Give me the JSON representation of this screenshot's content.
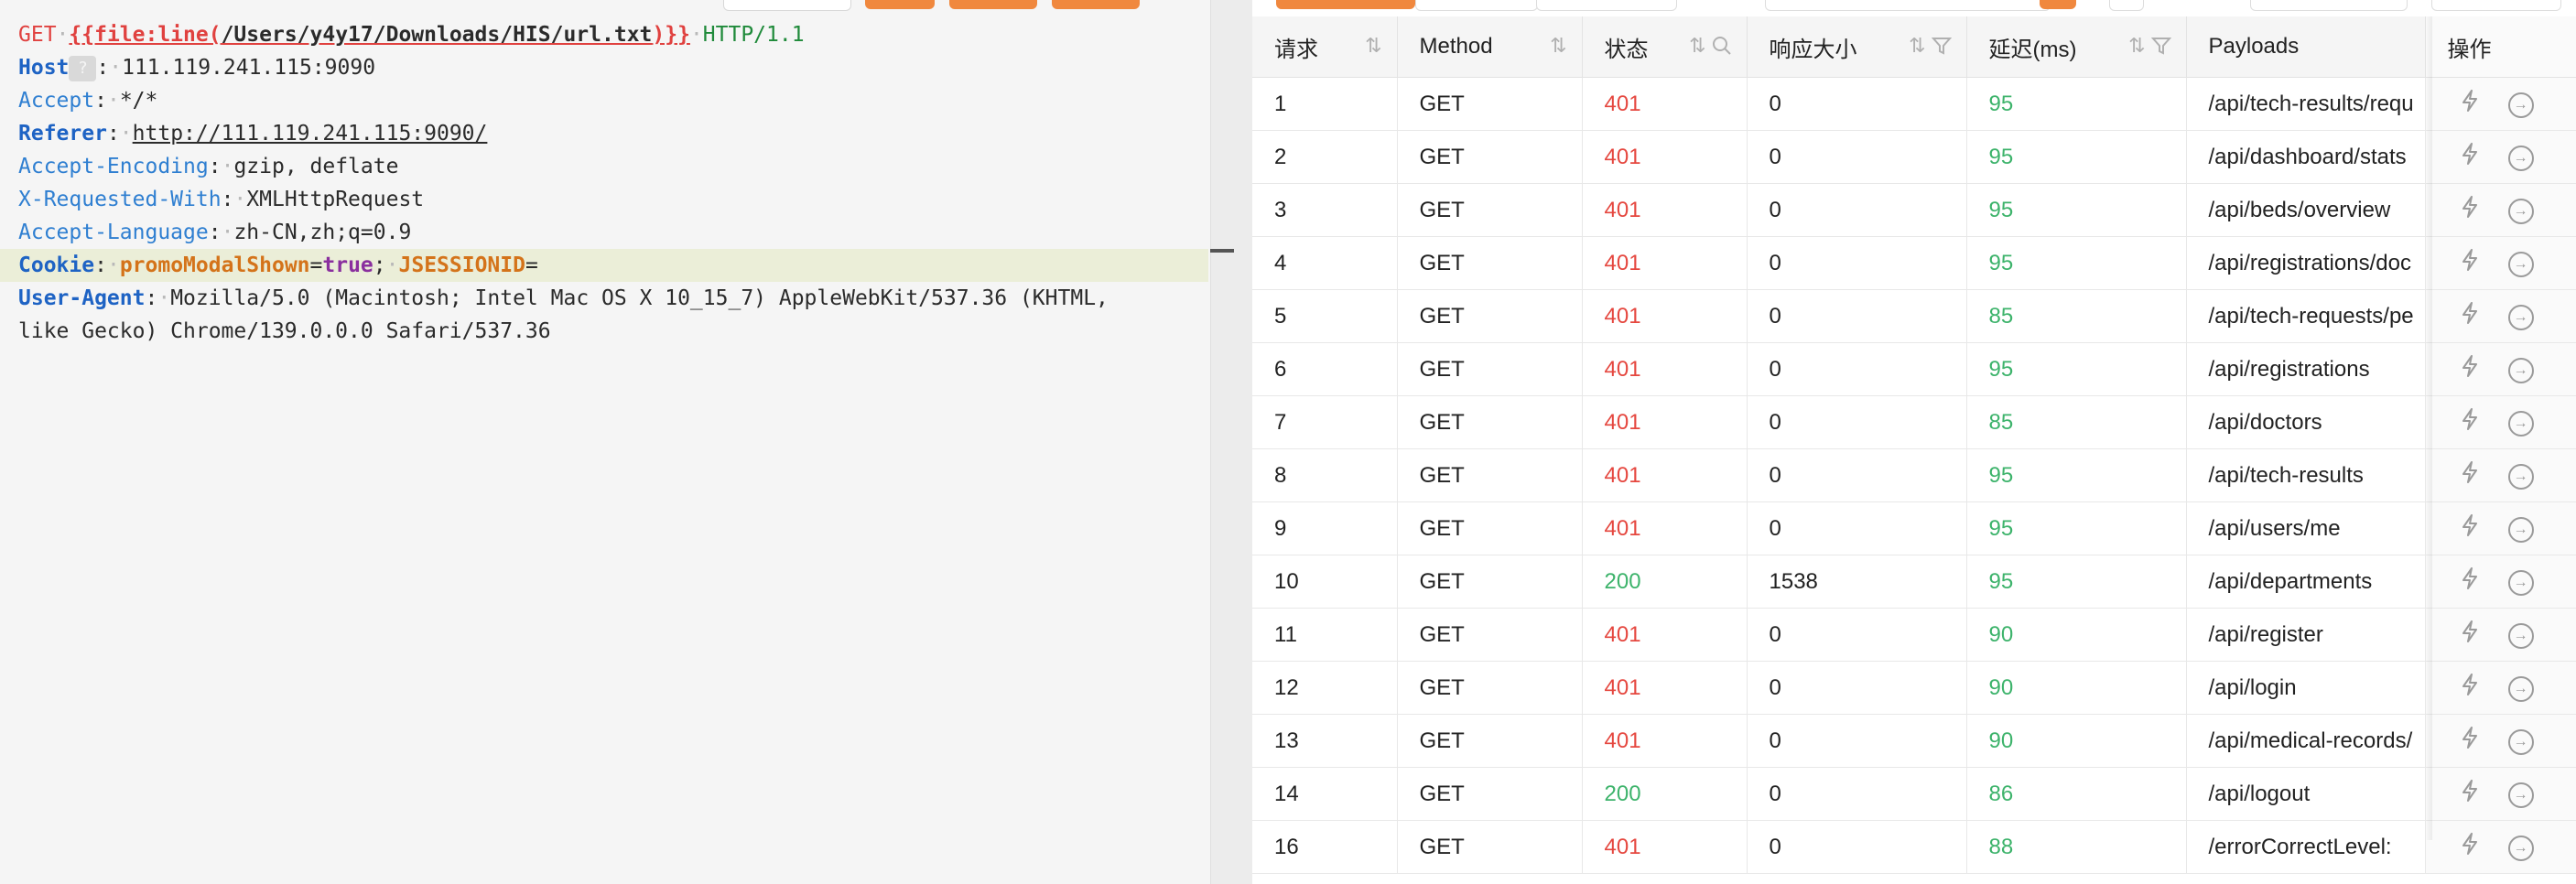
{
  "editor": {
    "request_line": {
      "method": "GET",
      "template_open": "{{file:line(",
      "template_path": "/Users/y4y17/Downloads/HIS/url.txt",
      "template_close": ")}}",
      "protocol": "HTTP/1.1"
    },
    "headers": [
      {
        "name": "Host",
        "value": "111.119.241.115:9090"
      },
      {
        "name": "Accept",
        "value": "*/*"
      },
      {
        "name": "Referer",
        "value": "http://111.119.241.115:9090/"
      },
      {
        "name": "Accept-Encoding",
        "value": "gzip, deflate"
      },
      {
        "name": "X-Requested-With",
        "value": "XMLHttpRequest"
      },
      {
        "name": "Accept-Language",
        "value": "zh-CN,zh;q=0.9"
      },
      {
        "name": "Cookie",
        "cookie1_name": "promoModalShown",
        "cookie1_value": "true",
        "cookie2_name": "JSESSIONID",
        "eq": "="
      },
      {
        "name": "User-Agent",
        "value_line1": "Mozilla/5.0 (Macintosh; Intel Mac OS X 10_15_7) AppleWebKit/537.36 (KHTML,",
        "value_line2": "like Gecko) Chrome/139.0.0.0 Safari/537.36"
      }
    ],
    "hint_glyph": "?"
  },
  "table": {
    "columns": {
      "request": "请求",
      "method": "Method",
      "status": "状态",
      "size": "响应大小",
      "latency": "延迟(ms)",
      "payloads": "Payloads",
      "actions": "操作"
    },
    "rows": [
      {
        "id": "1",
        "method": "GET",
        "status": "401",
        "size": "0",
        "latency": "95",
        "payload": "/api/tech-results/requ"
      },
      {
        "id": "2",
        "method": "GET",
        "status": "401",
        "size": "0",
        "latency": "95",
        "payload": "/api/dashboard/stats"
      },
      {
        "id": "3",
        "method": "GET",
        "status": "401",
        "size": "0",
        "latency": "95",
        "payload": "/api/beds/overview"
      },
      {
        "id": "4",
        "method": "GET",
        "status": "401",
        "size": "0",
        "latency": "95",
        "payload": "/api/registrations/doc"
      },
      {
        "id": "5",
        "method": "GET",
        "status": "401",
        "size": "0",
        "latency": "85",
        "payload": "/api/tech-requests/pe"
      },
      {
        "id": "6",
        "method": "GET",
        "status": "401",
        "size": "0",
        "latency": "95",
        "payload": "/api/registrations"
      },
      {
        "id": "7",
        "method": "GET",
        "status": "401",
        "size": "0",
        "latency": "85",
        "payload": "/api/doctors"
      },
      {
        "id": "8",
        "method": "GET",
        "status": "401",
        "size": "0",
        "latency": "95",
        "payload": "/api/tech-results"
      },
      {
        "id": "9",
        "method": "GET",
        "status": "401",
        "size": "0",
        "latency": "95",
        "payload": "/api/users/me"
      },
      {
        "id": "10",
        "method": "GET",
        "status": "200",
        "size": "1538",
        "latency": "95",
        "payload": "/api/departments"
      },
      {
        "id": "11",
        "method": "GET",
        "status": "401",
        "size": "0",
        "latency": "90",
        "payload": "/api/register"
      },
      {
        "id": "12",
        "method": "GET",
        "status": "401",
        "size": "0",
        "latency": "90",
        "payload": "/api/login"
      },
      {
        "id": "13",
        "method": "GET",
        "status": "401",
        "size": "0",
        "latency": "90",
        "payload": "/api/medical-records/"
      },
      {
        "id": "14",
        "method": "GET",
        "status": "200",
        "size": "0",
        "latency": "86",
        "payload": "/api/logout"
      },
      {
        "id": "16",
        "method": "GET",
        "status": "401",
        "size": "0",
        "latency": "88",
        "payload": "/errorCorrectLevel:"
      }
    ]
  },
  "colors": {
    "status_error": "#e5473f",
    "status_ok": "#3db36b",
    "accent_orange": "#f0883e"
  },
  "icons": {
    "sort": "sort-icon",
    "search": "search-icon",
    "filter": "filter-icon",
    "replay": "lightning-icon",
    "open": "arrow-circle-icon"
  }
}
